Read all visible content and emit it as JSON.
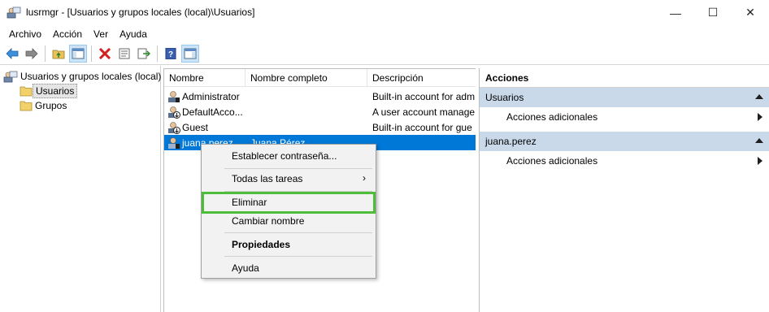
{
  "window": {
    "title": "lusrmgr - [Usuarios y grupos locales (local)\\Usuarios]",
    "minimize_glyph": "—",
    "maximize_glyph": "☐",
    "close_glyph": "✕"
  },
  "menu": [
    "Archivo",
    "Acción",
    "Ver",
    "Ayuda"
  ],
  "toolbar": {
    "icons": [
      "back-arrow-icon",
      "forward-arrow-icon",
      "up-folder-icon",
      "show-hide-tree-icon",
      "delete-icon",
      "properties-icon",
      "export-list-icon",
      "help-icon",
      "show-hide-action-pane-icon"
    ]
  },
  "tree": {
    "root": "Usuarios y grupos locales (local)",
    "children": [
      "Usuarios",
      "Grupos"
    ],
    "selected": "Usuarios"
  },
  "list": {
    "columns": [
      "Nombre",
      "Nombre completo",
      "Descripción"
    ],
    "rows": [
      {
        "name": "Administrator",
        "full_name": "",
        "description": "Built-in account for adm"
      },
      {
        "name": "DefaultAcco...",
        "full_name": "",
        "description": "A user account manage"
      },
      {
        "name": "Guest",
        "full_name": "",
        "description": "Built-in account for gue"
      },
      {
        "name": "juana.perez",
        "full_name": "Juana Pérez",
        "description": ""
      }
    ],
    "selected_row": 3
  },
  "actions": {
    "header": "Acciones",
    "sections": [
      {
        "title": "Usuarios",
        "items": [
          "Acciones adicionales"
        ]
      },
      {
        "title": "juana.perez",
        "items": [
          "Acciones adicionales"
        ]
      }
    ]
  },
  "context_menu": {
    "items": [
      {
        "label": "Establecer contraseña..."
      },
      {
        "label": "Todas las tareas",
        "submenu_glyph": "›"
      },
      {
        "label": "Eliminar"
      },
      {
        "label": "Cambiar nombre"
      },
      {
        "label": "Propiedades"
      },
      {
        "label": "Ayuda"
      }
    ],
    "highlighted": "Eliminar"
  },
  "colors": {
    "selection_blue": "#0078d7",
    "highlight_green": "#4ebe3a",
    "section_header": "#c9d9ea"
  }
}
